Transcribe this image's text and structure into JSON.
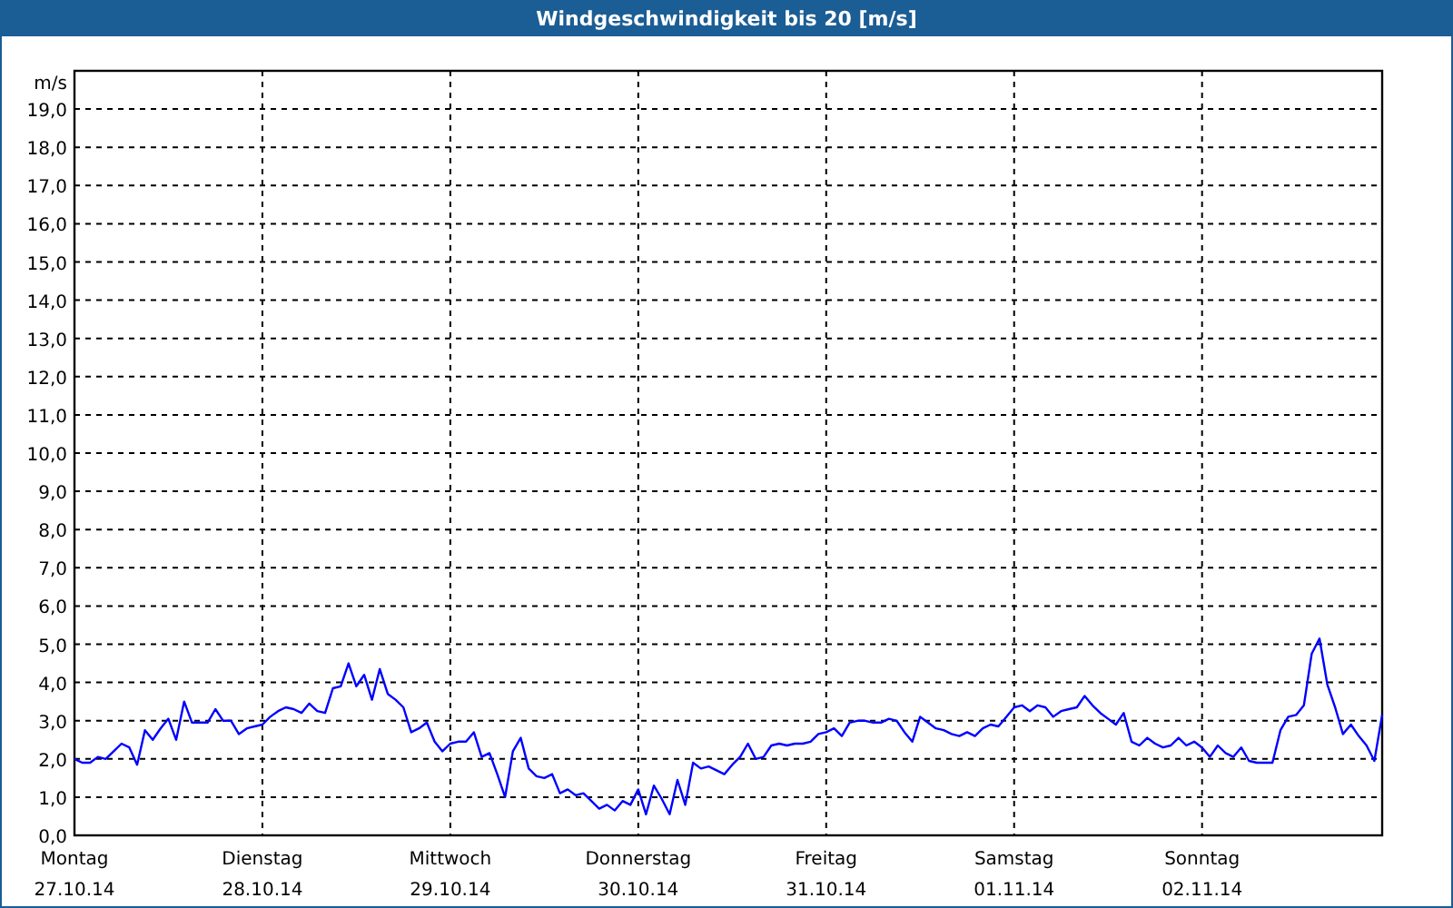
{
  "window": {
    "title": "Windgeschwindigkeit bis 20 [m/s]"
  },
  "chart": {
    "day_dates": [
      "27.10.14",
      "28.10.14",
      "29.10.14",
      "30.10.14",
      "31.10.14",
      "01.11.14",
      "02.11.14"
    ],
    "chart_data": {
      "type": "line",
      "ylabel": "m/s",
      "ylim": [
        0,
        20
      ],
      "grid": true,
      "yticks": [
        {
          "value": 0,
          "label": "0,0"
        },
        {
          "value": 1,
          "label": "1,0"
        },
        {
          "value": 2,
          "label": "2,0"
        },
        {
          "value": 3,
          "label": "3,0"
        },
        {
          "value": 4,
          "label": "4,0"
        },
        {
          "value": 5,
          "label": "5,0"
        },
        {
          "value": 6,
          "label": "6,0"
        },
        {
          "value": 7,
          "label": "7,0"
        },
        {
          "value": 8,
          "label": "8,0"
        },
        {
          "value": 9,
          "label": "9,0"
        },
        {
          "value": 10,
          "label": "10,0"
        },
        {
          "value": 11,
          "label": "11,0"
        },
        {
          "value": 12,
          "label": "12,0"
        },
        {
          "value": 13,
          "label": "13,0"
        },
        {
          "value": 14,
          "label": "14,0"
        },
        {
          "value": 15,
          "label": "15,0"
        },
        {
          "value": 16,
          "label": "16,0"
        },
        {
          "value": 17,
          "label": "17,0"
        },
        {
          "value": 18,
          "label": "18,0"
        },
        {
          "value": 19,
          "label": "19,0"
        }
      ],
      "categories": [
        "Montag",
        null,
        null,
        null,
        null,
        null,
        null,
        null,
        null,
        null,
        null,
        null,
        null,
        null,
        null,
        null,
        null,
        null,
        null,
        null,
        null,
        null,
        null,
        null,
        "Dienstag",
        null,
        null,
        null,
        null,
        null,
        null,
        null,
        null,
        null,
        null,
        null,
        null,
        null,
        null,
        null,
        null,
        null,
        null,
        null,
        null,
        null,
        null,
        null,
        "Mittwoch",
        null,
        null,
        null,
        null,
        null,
        null,
        null,
        null,
        null,
        null,
        null,
        null,
        null,
        null,
        null,
        null,
        null,
        null,
        null,
        null,
        null,
        null,
        null,
        "Donnerstag",
        null,
        null,
        null,
        null,
        null,
        null,
        null,
        null,
        null,
        null,
        null,
        null,
        null,
        null,
        null,
        null,
        null,
        null,
        null,
        null,
        null,
        null,
        null,
        "Freitag",
        null,
        null,
        null,
        null,
        null,
        null,
        null,
        null,
        null,
        null,
        null,
        null,
        null,
        null,
        null,
        null,
        null,
        null,
        null,
        null,
        null,
        null,
        null,
        "Samstag",
        null,
        null,
        null,
        null,
        null,
        null,
        null,
        null,
        null,
        null,
        null,
        null,
        null,
        null,
        null,
        null,
        null,
        null,
        null,
        null,
        null,
        null,
        null,
        "Sonntag",
        null,
        null,
        null,
        null,
        null,
        null,
        null,
        null,
        null,
        null,
        null,
        null,
        null,
        null,
        null,
        null,
        null,
        null,
        null,
        null,
        null,
        null,
        null
      ],
      "series": [
        {
          "color": "#0000ff",
          "values": [
            2.0,
            1.9,
            1.9,
            2.05,
            2.0,
            2.2,
            2.4,
            2.3,
            1.85,
            2.75,
            2.5,
            2.8,
            3.05,
            2.5,
            3.5,
            2.95,
            2.95,
            2.95,
            3.3,
            3.0,
            3.0,
            2.65,
            2.8,
            2.85,
            2.9,
            3.1,
            3.25,
            3.35,
            3.3,
            3.2,
            3.45,
            3.25,
            3.2,
            3.85,
            3.9,
            4.5,
            3.9,
            4.2,
            3.55,
            4.35,
            3.7,
            3.55,
            3.35,
            2.7,
            2.8,
            2.95,
            2.45,
            2.2,
            2.4,
            2.45,
            2.45,
            2.7,
            2.05,
            2.15,
            1.6,
            1.0,
            2.2,
            2.55,
            1.75,
            1.55,
            1.5,
            1.6,
            1.1,
            1.2,
            1.05,
            1.1,
            0.9,
            0.7,
            0.8,
            0.65,
            0.9,
            0.8,
            1.2,
            0.55,
            1.3,
            0.95,
            0.55,
            1.45,
            0.8,
            1.9,
            1.75,
            1.8,
            1.7,
            1.6,
            1.85,
            2.05,
            2.4,
            2.0,
            2.05,
            2.35,
            2.4,
            2.35,
            2.4,
            2.4,
            2.45,
            2.65,
            2.7,
            2.8,
            2.6,
            2.95,
            3.0,
            3.0,
            2.95,
            2.95,
            3.05,
            3.0,
            2.7,
            2.45,
            3.1,
            2.95,
            2.8,
            2.75,
            2.65,
            2.6,
            2.7,
            2.6,
            2.8,
            2.9,
            2.85,
            3.1,
            3.35,
            3.4,
            3.25,
            3.4,
            3.35,
            3.1,
            3.25,
            3.3,
            3.35,
            3.65,
            3.4,
            3.2,
            3.05,
            2.9,
            3.2,
            2.45,
            2.35,
            2.55,
            2.4,
            2.3,
            2.35,
            2.55,
            2.35,
            2.45,
            2.3,
            2.05,
            2.35,
            2.15,
            2.05,
            2.3,
            1.95,
            1.9,
            1.9,
            1.9,
            2.75,
            3.1,
            3.15,
            3.4,
            4.75,
            5.15,
            3.95,
            3.35,
            2.65,
            2.9,
            2.6,
            2.35,
            1.95,
            3.15
          ]
        }
      ]
    }
  }
}
